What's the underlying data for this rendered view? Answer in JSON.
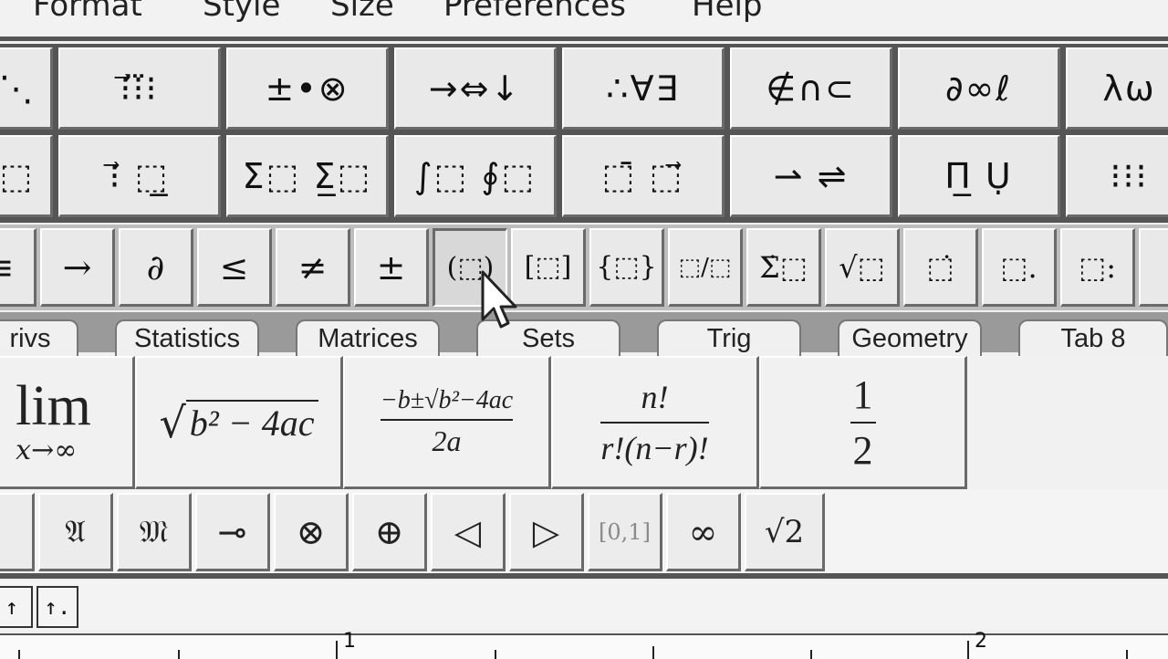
{
  "menu": {
    "items": [
      "Format",
      "Style",
      "Size",
      "Preferences",
      "Help"
    ]
  },
  "palette_row1": {
    "buttons": [
      "⋱",
      "⁝⃗⁝⃛⁝",
      "±•⊗",
      "→⇔↓",
      "∴∀∃",
      "∉∩⊂",
      "∂∞ℓ",
      "λω"
    ]
  },
  "palette_row2": {
    "buttons": [
      "⬚",
      "⁝⃗ ⬚̲",
      "Σ⬚ Σ̲⬚",
      "∫⬚ ∮⬚",
      "⬚̄ ⬚⃗",
      "⇀ ⇌",
      "Π̲ Ụ",
      "⁝⁝⁝"
    ]
  },
  "palette_row3": {
    "buttons": [
      "≡",
      "→",
      "∂",
      "≤",
      "≠",
      "±",
      "(⬚)",
      "[⬚]",
      "{⬚}",
      "⬚/⬚",
      "Σ̇⬚",
      "√⬚",
      "⬚̇",
      "⬚.",
      "⬚:"
    ]
  },
  "tabs": [
    "rivs",
    "Statistics",
    "Matrices",
    "Sets",
    "Trig",
    "Geometry",
    "Tab 8"
  ],
  "templates": {
    "lim": "lim",
    "lim_sub": "x→∞",
    "sqrt_disc": "b² − 4ac",
    "quad_num": "−b±√b²−4ac",
    "quad_den": "2a",
    "comb_num": "n!",
    "comb_den": "r!(n−r)!",
    "half_num": "1",
    "half_den": "2"
  },
  "symbols_row": [
    "",
    "𝔄",
    "𝔐",
    "⊸",
    "⊗",
    "⊕",
    "◁",
    "▷",
    "[0,1]",
    "∞",
    "√2"
  ],
  "lower_buttons": [
    "↑",
    "↑."
  ],
  "ruler": {
    "labels": [
      "1",
      "2"
    ]
  }
}
